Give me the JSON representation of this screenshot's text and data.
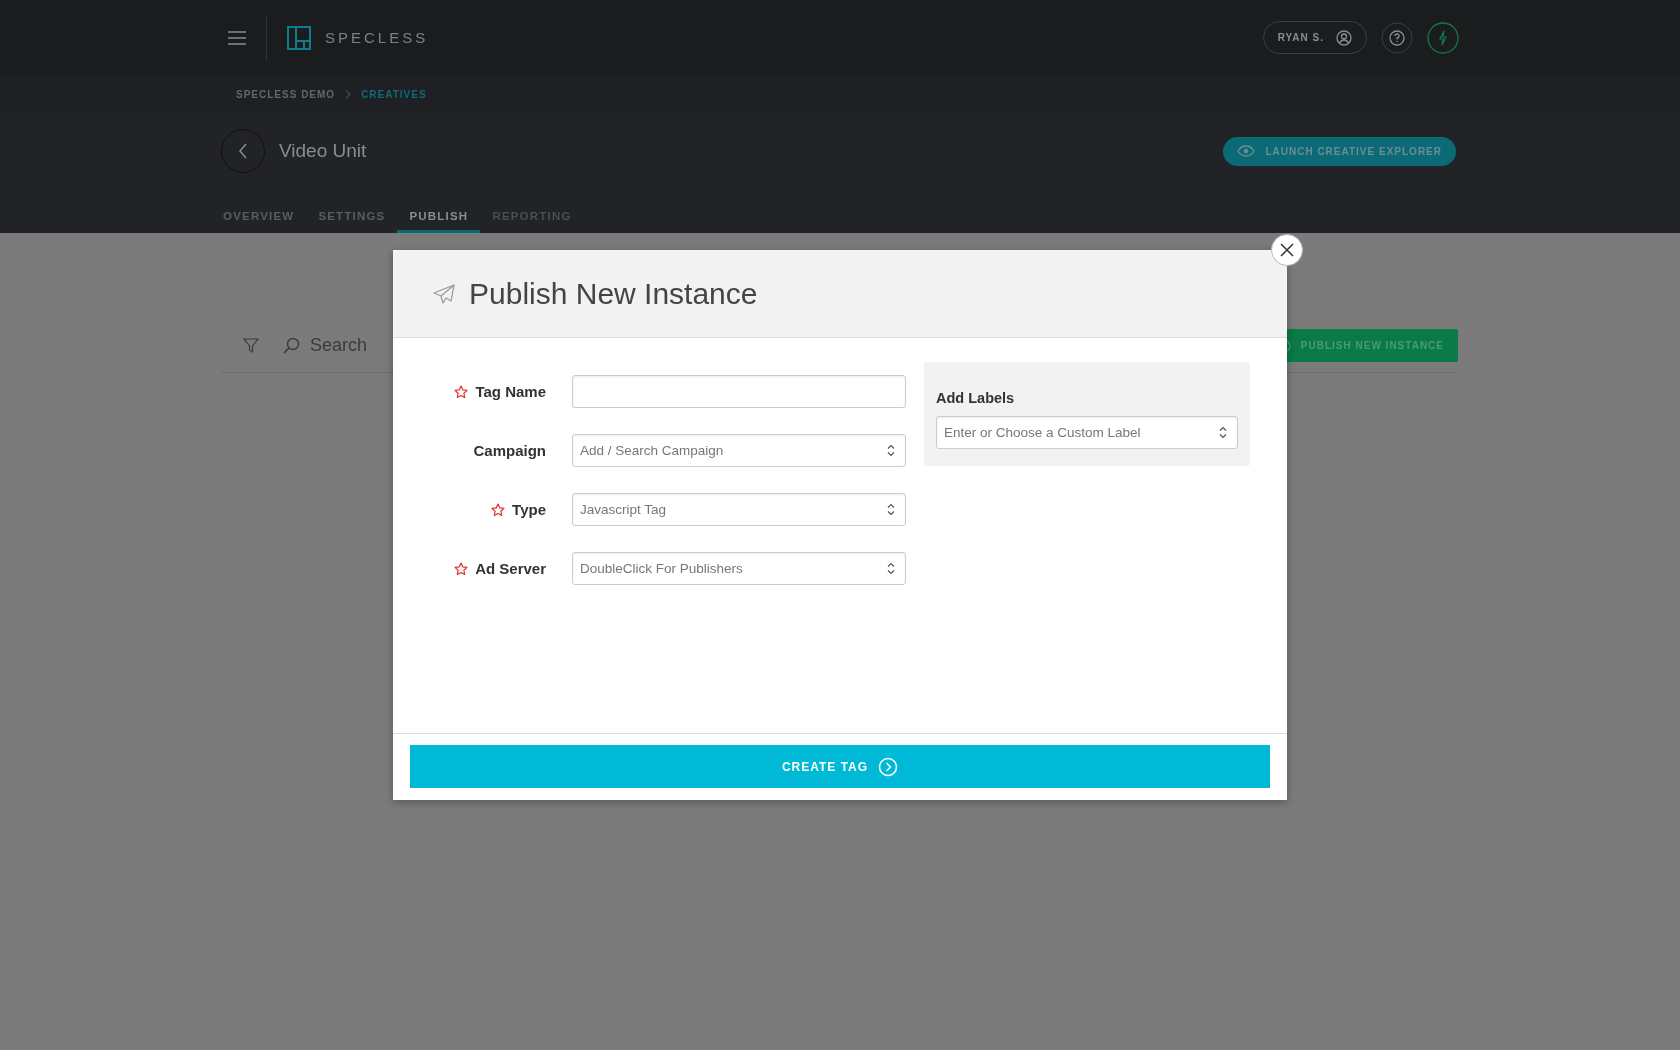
{
  "app": {
    "logo_text": "SPECLESS",
    "user": "RYAN S."
  },
  "breadcrumb": [
    {
      "label": "SPECLESS DEMO",
      "selected": false
    },
    {
      "label": "CREATIVES",
      "selected": true
    }
  ],
  "page": {
    "title": "Video Unit",
    "action": "LAUNCH CREATIVE EXPLORER"
  },
  "tabs": [
    {
      "label": "OVERVIEW",
      "selected": false,
      "disabled": false
    },
    {
      "label": "SETTINGS",
      "selected": false,
      "disabled": false
    },
    {
      "label": "PUBLISH",
      "selected": true,
      "disabled": false
    },
    {
      "label": "REPORTING",
      "selected": false,
      "disabled": true
    }
  ],
  "toolbar": {
    "search_placeholder": "Search",
    "publish_button": "PUBLISH NEW INSTANCE"
  },
  "modal": {
    "title": "Publish New Instance",
    "fields": [
      {
        "label": "Tag Name",
        "required": true,
        "kind": "text"
      },
      {
        "label": "Campaign",
        "required": false,
        "kind": "select",
        "placeholder": "Add / Search Campaign"
      },
      {
        "label": "Type",
        "required": true,
        "kind": "select",
        "value": "Javascript Tag"
      },
      {
        "label": "Ad Server",
        "required": true,
        "kind": "select",
        "value": "DoubleClick For Publishers"
      }
    ],
    "labels_panel": {
      "title": "Add Labels",
      "placeholder": "Enter or Choose a Custom Label"
    },
    "submit": "CREATE TAG"
  }
}
